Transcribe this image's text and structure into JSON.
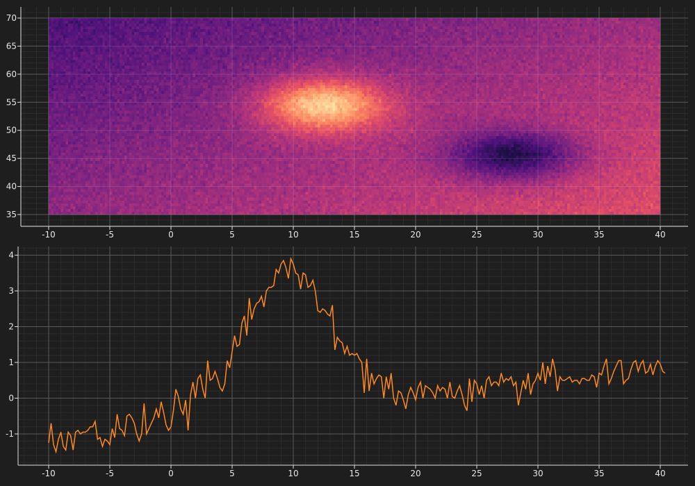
{
  "theme": {
    "background": "#1e1e1e",
    "axis_color": "#e0e0e0",
    "major_grid": "#5a5a5a",
    "minor_grid": "#2c2c2c",
    "line_color": "#ff8a1e",
    "colormap": "magma"
  },
  "chart_data": [
    {
      "type": "heatmap",
      "title": "",
      "xlabel": "",
      "ylabel": "",
      "colormap": "magma",
      "xlim": [
        -10,
        40
      ],
      "ylim": [
        35,
        70
      ],
      "grid": true,
      "xticks": [
        "-10",
        "-5",
        "0",
        "5",
        "10",
        "15",
        "20",
        "25",
        "30",
        "35",
        "40"
      ],
      "yticks": [
        "35",
        "40",
        "45",
        "50",
        "55",
        "60",
        "65",
        "70"
      ],
      "grid_resolution": {
        "x_bins": 250,
        "y_bins": 70
      },
      "features": [
        {
          "kind": "peak",
          "center": [
            12.5,
            54.5
          ],
          "sigma": [
            3.6,
            3.4
          ],
          "amplitude": 1.0
        },
        {
          "kind": "trough",
          "center": [
            28,
            45.5
          ],
          "sigma": [
            3.6,
            3.0
          ],
          "amplitude": -1.0
        },
        {
          "kind": "trend",
          "description": "low at top-left, rising toward bottom-right"
        }
      ],
      "value_range": [
        -1.2,
        1.5
      ]
    },
    {
      "type": "line",
      "title": "",
      "xlabel": "",
      "ylabel": "",
      "xlim": [
        -10,
        40
      ],
      "ylim": [
        -1.8,
        4.2
      ],
      "grid": true,
      "xticks": [
        "-10",
        "-5",
        "0",
        "5",
        "10",
        "15",
        "20",
        "25",
        "30",
        "35",
        "40"
      ],
      "yticks": [
        "-1",
        "0",
        "1",
        "2",
        "3",
        "4"
      ],
      "series": [
        {
          "color": "#ff8a1e",
          "x_start": -10,
          "x_step": 0.2,
          "values": [
            -1.25,
            -0.7,
            -1.3,
            -1.5,
            -1.15,
            -0.95,
            -1.35,
            -1.45,
            -0.95,
            -1.05,
            -1.45,
            -0.95,
            -0.9,
            -1.0,
            -0.95,
            -0.95,
            -0.9,
            -0.8,
            -0.8,
            -0.65,
            -1.15,
            -1.1,
            -1.35,
            -1.15,
            -1.2,
            -1.3,
            -0.85,
            -1.1,
            -0.45,
            -0.85,
            -0.9,
            -1.05,
            -0.5,
            -0.45,
            -0.55,
            -0.7,
            -1.0,
            -1.2,
            -1.0,
            -0.15,
            -1.0,
            -0.85,
            -0.7,
            -0.55,
            -0.3,
            -0.55,
            -0.1,
            -0.4,
            -0.75,
            -0.9,
            -0.8,
            -0.35,
            0.25,
            0.05,
            -0.3,
            -0.45,
            -0.05,
            -0.9,
            0.1,
            0.45,
            0.0,
            0.55,
            0.65,
            0.25,
            0.0,
            1.05,
            0.5,
            0.55,
            0.75,
            0.55,
            0.3,
            0.2,
            0.4,
            1.05,
            0.85,
            1.3,
            1.75,
            1.45,
            1.5,
            2.1,
            2.3,
            1.75,
            2.8,
            2.2,
            2.5,
            2.65,
            2.7,
            2.85,
            2.55,
            3.0,
            3.1,
            3.1,
            3.15,
            3.6,
            3.5,
            3.75,
            3.85,
            3.65,
            3.35,
            3.9,
            3.75,
            3.5,
            3.45,
            3.05,
            3.5,
            3.45,
            3.1,
            3.15,
            3.3,
            3.0,
            2.45,
            2.4,
            2.5,
            2.45,
            2.35,
            2.3,
            2.6,
            1.35,
            1.7,
            1.6,
            1.55,
            1.25,
            1.45,
            1.2,
            1.25,
            1.2,
            1.25,
            1.1,
            1.0,
            0.15,
            1.1,
            0.2,
            0.7,
            0.4,
            0.55,
            0.65,
            0.6,
            0.0,
            0.6,
            0.25,
            0.7,
            0.0,
            -0.2,
            0.2,
            0.15,
            -0.05,
            -0.3,
            0.1,
            0.3,
            0.15,
            -0.05,
            0.3,
            0.45,
            0.0,
            0.35,
            0.3,
            0.25,
            0.15,
            0.0,
            0.35,
            0.2,
            0.3,
            0.25,
            0.0,
            0.45,
            0.05,
            0.0,
            0.2,
            0.35,
            0.1,
            -0.2,
            -0.35,
            0.55,
            -0.1,
            0.5,
            0.4,
            0.1,
            0.35,
            0.0,
            0.5,
            0.6,
            0.35,
            0.45,
            0.45,
            0.35,
            0.7,
            0.45,
            0.55,
            0.5,
            0.6,
            0.35,
            0.45,
            -0.2,
            0.15,
            0.5,
            0.25,
            0.7,
            0.1,
            0.4,
            0.5,
            0.7,
            0.5,
            1.0,
            0.4,
            0.9,
            0.6,
            1.1,
            0.8,
            0.2,
            0.6,
            0.5,
            0.5,
            0.55,
            0.6,
            0.45,
            0.5,
            0.5,
            0.4,
            0.55,
            0.55,
            0.5,
            0.5,
            0.65,
            0.6,
            0.3,
            0.7,
            0.65,
            0.9,
            1.1,
            0.4,
            0.55,
            0.75,
            0.9,
            1.05,
            1.05,
            0.4,
            0.5,
            0.55,
            0.8,
            1.0,
            1.05,
            0.75,
            0.95,
            1.05,
            0.7,
            0.75,
            0.95,
            0.65,
            0.9,
            1.05,
            0.95,
            0.75,
            0.7
          ]
        }
      ]
    }
  ]
}
